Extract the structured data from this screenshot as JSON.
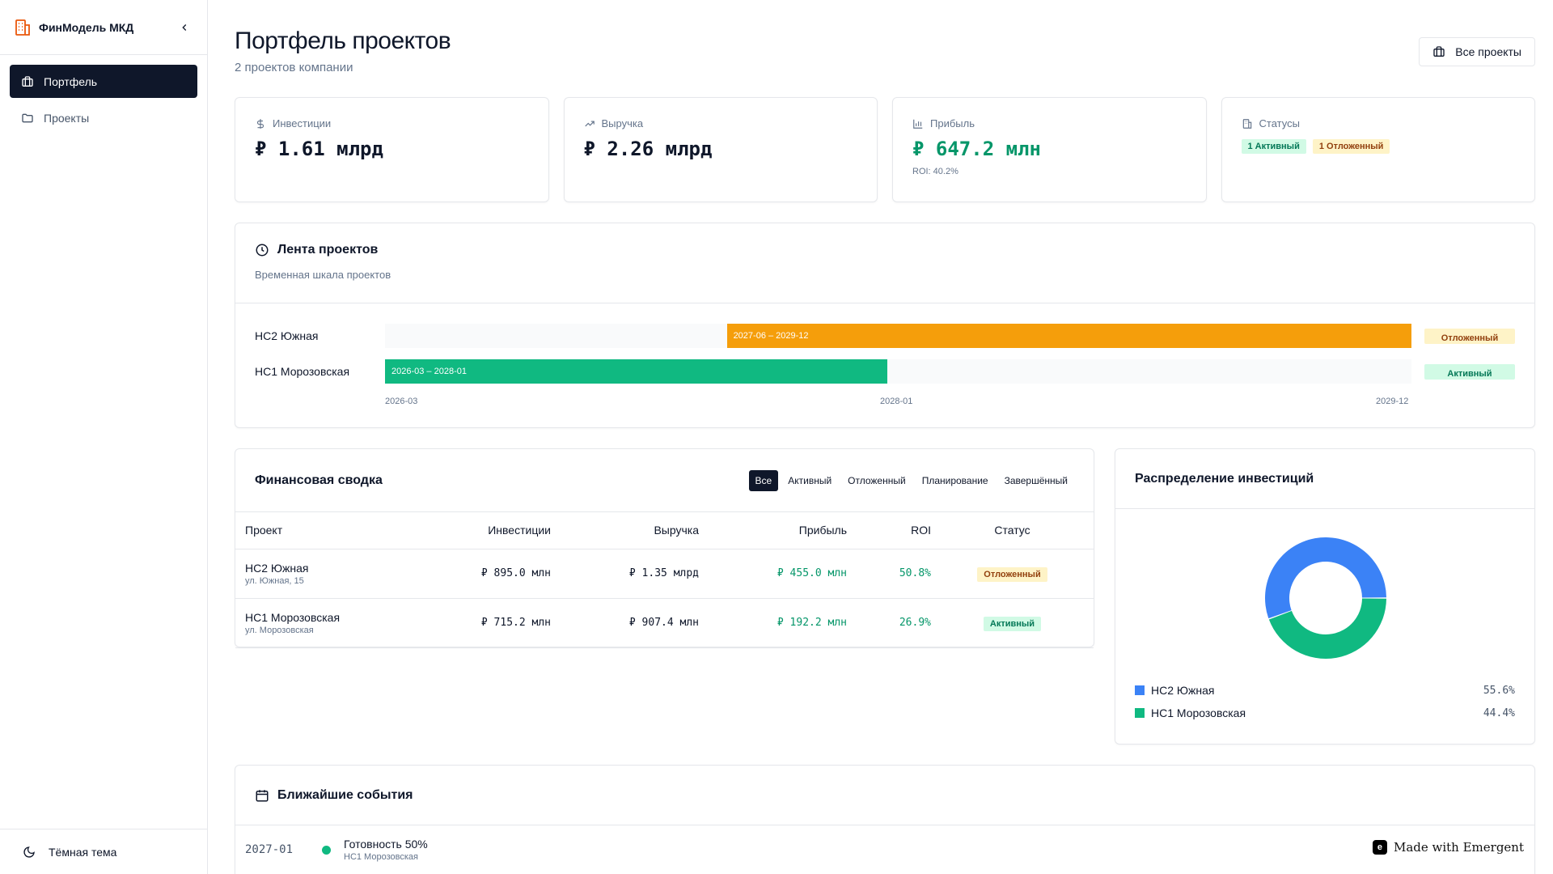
{
  "sidebar": {
    "brand": "ФинМодель МКД",
    "nav": [
      {
        "label": "Портфель",
        "icon": "briefcase-icon",
        "active": true
      },
      {
        "label": "Проекты",
        "icon": "folder-icon",
        "active": false
      }
    ],
    "theme_label": "Тёмная тема"
  },
  "header": {
    "title": "Портфель проектов",
    "subtitle": "2 проектов компании",
    "all_projects": "Все проекты"
  },
  "kpis": {
    "investments": {
      "label": "Инвестиции",
      "value": "₽ 1.61 млрд"
    },
    "revenue": {
      "label": "Выручка",
      "value": "₽ 2.26 млрд"
    },
    "profit": {
      "label": "Прибыль",
      "value": "₽ 647.2 млн",
      "note": "ROI: 40.2%"
    },
    "statuses": {
      "label": "Статусы",
      "active": "1 Активный",
      "delayed": "1 Отложенный"
    }
  },
  "timeline": {
    "title": "Лента проектов",
    "desc": "Временная шкала проектов",
    "rows": [
      {
        "name": "НС2 Южная",
        "range": "2027-06 – 2029-12",
        "status": "Отложенный",
        "start_frac": 0.333,
        "end_frac": 1.0,
        "color": "#f59e0b"
      },
      {
        "name": "НС1 Морозовская",
        "range": "2026-03 – 2028-01",
        "status": "Активный",
        "start_frac": 0.0,
        "end_frac": 0.489,
        "color": "#10b981"
      }
    ],
    "axis": [
      "2026-03",
      "2028-01",
      "2029-12"
    ]
  },
  "finance": {
    "title": "Финансовая сводка",
    "filters": [
      "Все",
      "Активный",
      "Отложенный",
      "Планирование",
      "Завершённый"
    ],
    "columns": [
      "Проект",
      "Инвестиции",
      "Выручка",
      "Прибыль",
      "ROI",
      "Статус"
    ],
    "rows": [
      {
        "name": "НС2 Южная",
        "addr": "ул. Южная, 15",
        "inv": "₽ 895.0 млн",
        "rev": "₽ 1.35 млрд",
        "profit": "₽ 455.0 млн",
        "roi": "50.8%",
        "status": "Отложенный"
      },
      {
        "name": "НС1 Морозовская",
        "addr": "ул. Морозовская",
        "inv": "₽ 715.2 млн",
        "rev": "₽ 907.4 млн",
        "profit": "₽ 192.2 млн",
        "roi": "26.9%",
        "status": "Активный"
      }
    ]
  },
  "distribution": {
    "title": "Распределение инвестиций",
    "items": [
      {
        "name": "НС2 Южная",
        "value": "55.6%",
        "share": 55.6,
        "color": "#3b82f6"
      },
      {
        "name": "НС1 Морозовская",
        "value": "44.4%",
        "share": 44.4,
        "color": "#10b981"
      }
    ]
  },
  "events": {
    "title": "Ближайшие события",
    "rows": [
      {
        "date": "2027-01",
        "name": "Готовность 50%",
        "project": "НС1 Морозовская"
      }
    ]
  },
  "footer": {
    "made_with": "Made with Emergent"
  }
}
